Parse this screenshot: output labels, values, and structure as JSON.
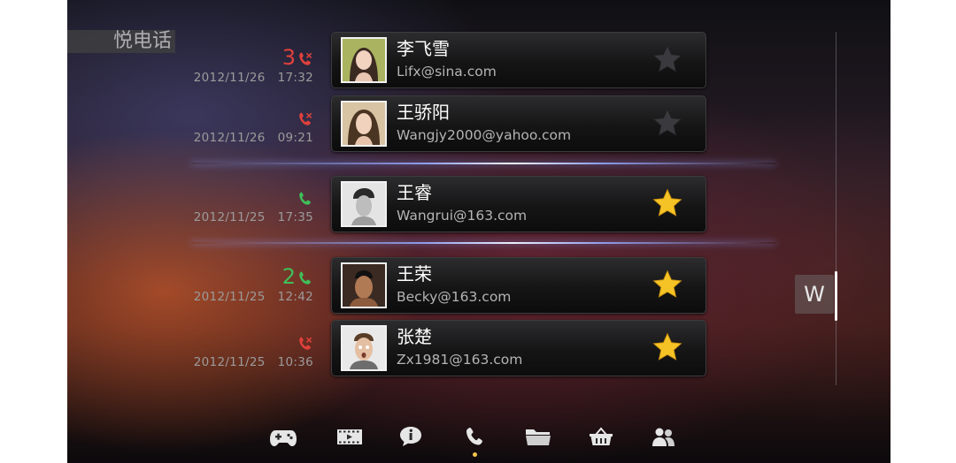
{
  "app": {
    "title": "悦电话"
  },
  "calls": [
    {
      "count": "3",
      "call_type": "missed",
      "color": "#e0413c",
      "date": "2012/11/26",
      "time": "17:32",
      "name": "李飞雪",
      "email": "Lifx@sina.com",
      "favorite": false,
      "avatar": "avatar-woman-1"
    },
    {
      "count": "",
      "call_type": "missed",
      "color": "#e0413c",
      "date": "2012/11/26",
      "time": "09:21",
      "name": "王骄阳",
      "email": "Wangjy2000@yahoo.com",
      "favorite": false,
      "avatar": "avatar-woman-2"
    },
    {
      "count": "",
      "call_type": "answered",
      "color": "#3fbf5a",
      "date": "2012/11/25",
      "time": "17:35",
      "name": "王睿",
      "email": "Wangrui@163.com",
      "favorite": true,
      "avatar": "avatar-man-1"
    },
    {
      "count": "2",
      "call_type": "answered",
      "color": "#3fbf5a",
      "date": "2012/11/25",
      "time": "12:42",
      "name": "王荣",
      "email": "Becky@163.com",
      "favorite": true,
      "avatar": "avatar-man-2"
    },
    {
      "count": "",
      "call_type": "missed",
      "color": "#e0413c",
      "date": "2012/11/25",
      "time": "10:36",
      "name": "张楚",
      "email": "Zx1981@163.com",
      "favorite": true,
      "avatar": "avatar-man-3"
    }
  ],
  "index": {
    "letter": "W"
  },
  "nav": {
    "items": [
      "gamepad-icon",
      "film-icon",
      "info-chat-icon",
      "phone-icon",
      "folder-icon",
      "basket-icon",
      "contacts-icon"
    ],
    "active": "phone-icon",
    "active_color": "#f3c64a"
  },
  "colors": {
    "favorite_star": "#f6c326",
    "star_off": "#3a3a3e",
    "missed": "#e0413c",
    "answered": "#3fbf5a"
  }
}
